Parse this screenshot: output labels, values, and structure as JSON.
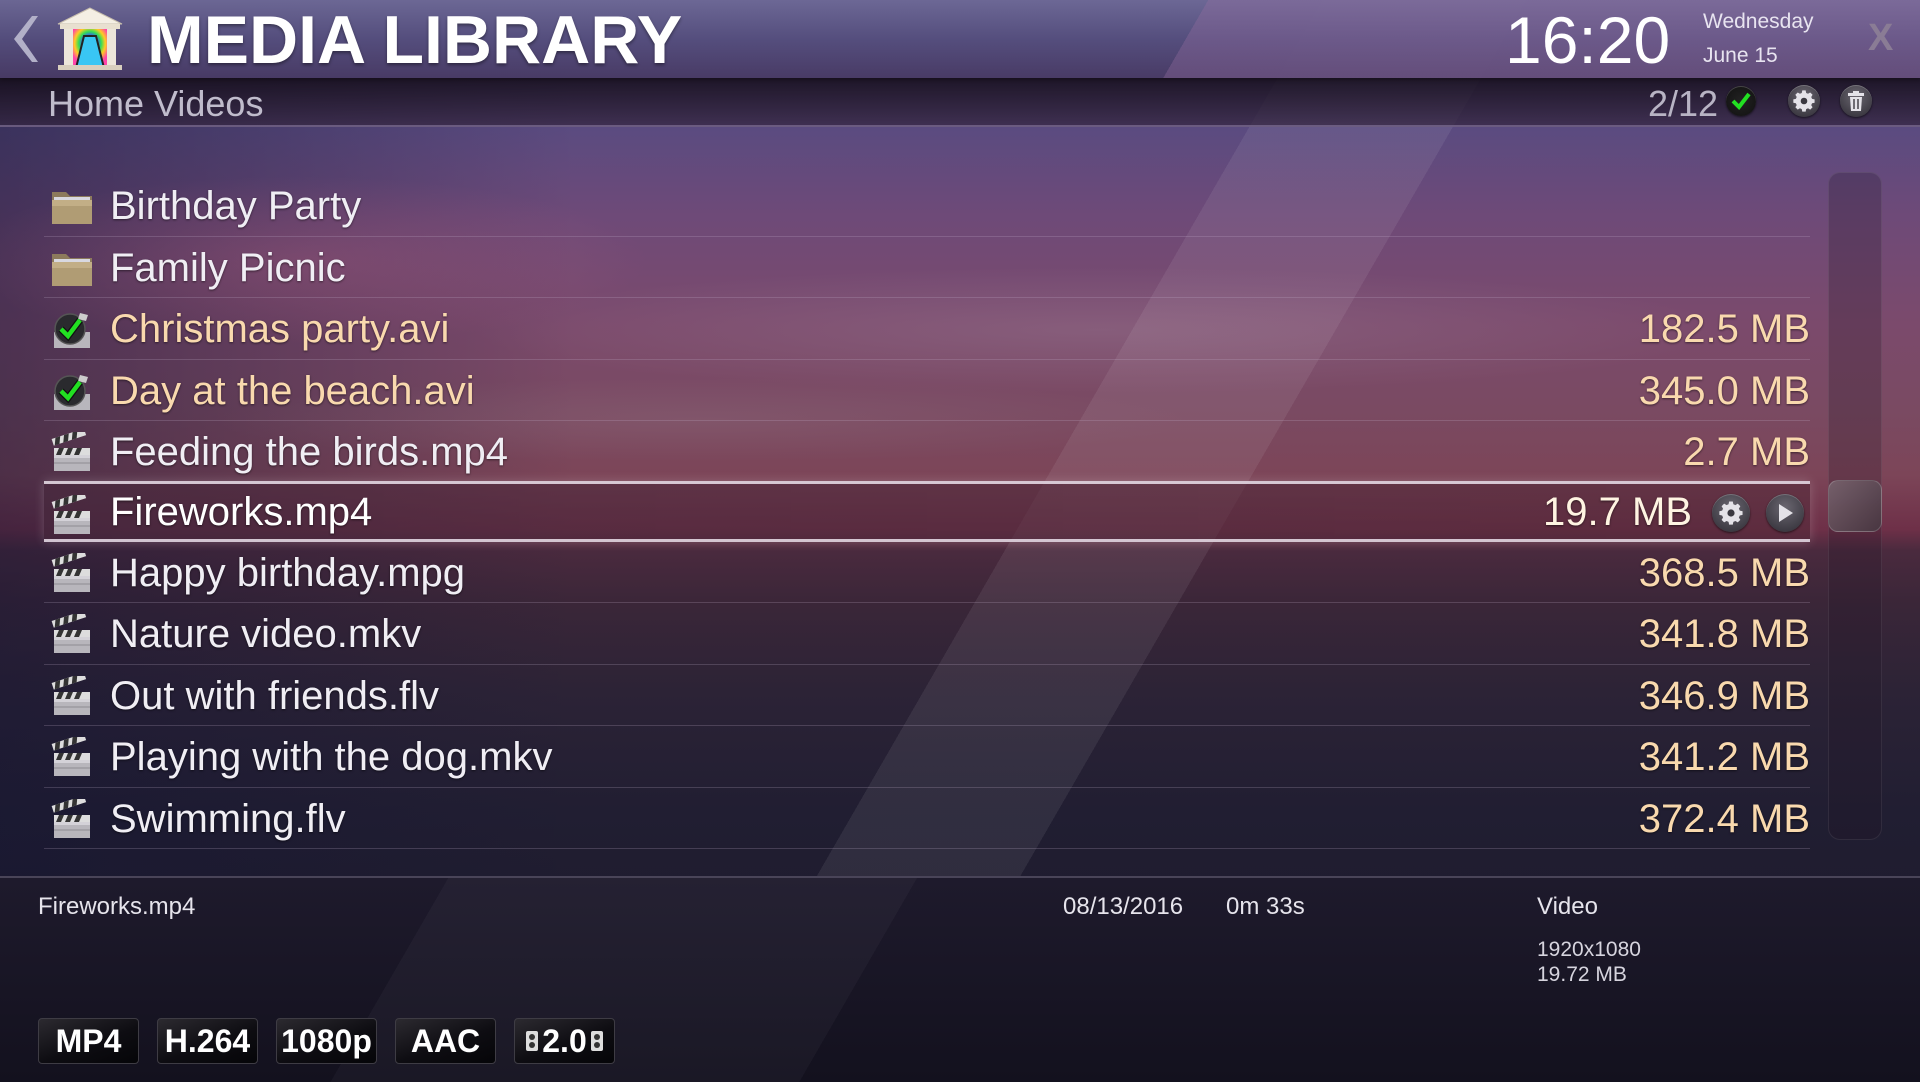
{
  "header": {
    "title": "MEDIA LIBRARY",
    "back_icon": "chevron-left-icon",
    "logo_icon": "media-library-logo-icon",
    "clock": "16:20",
    "day": "Wednesday",
    "date": "June 15",
    "close_label": "X"
  },
  "subheader": {
    "breadcrumb": "Home Videos",
    "counter": "2/12",
    "counter_icon": "checkmark-icon",
    "settings_icon": "gear-icon",
    "trash_icon": "trash-icon"
  },
  "colors": {
    "watched_text": "#f9d9ae",
    "normal_text": "#f0eef4",
    "check_green": "#22e022"
  },
  "files": [
    {
      "name": "Birthday Party",
      "type": "folder",
      "icon": "folder-icon",
      "size": "",
      "watched": false,
      "selected": false
    },
    {
      "name": "Family Picnic",
      "type": "folder",
      "icon": "folder-icon",
      "size": "",
      "watched": false,
      "selected": false
    },
    {
      "name": "Christmas party.avi",
      "type": "video",
      "icon": "watched-video-icon",
      "size": "182.5 MB",
      "watched": true,
      "selected": false
    },
    {
      "name": "Day at the beach.avi",
      "type": "video",
      "icon": "watched-video-icon",
      "size": "345.0 MB",
      "watched": true,
      "selected": false
    },
    {
      "name": "Feeding the birds.mp4",
      "type": "video",
      "icon": "clapperboard-icon",
      "size": "2.7 MB",
      "watched": false,
      "selected": false
    },
    {
      "name": "Fireworks.mp4",
      "type": "video",
      "icon": "clapperboard-icon",
      "size": "19.7 MB",
      "watched": false,
      "selected": true
    },
    {
      "name": "Happy birthday.mpg",
      "type": "video",
      "icon": "clapperboard-icon",
      "size": "368.5 MB",
      "watched": false,
      "selected": false
    },
    {
      "name": "Nature video.mkv",
      "type": "video",
      "icon": "clapperboard-icon",
      "size": "341.8 MB",
      "watched": false,
      "selected": false
    },
    {
      "name": "Out with friends.flv",
      "type": "video",
      "icon": "clapperboard-icon",
      "size": "346.9 MB",
      "watched": false,
      "selected": false
    },
    {
      "name": "Playing with the dog.mkv",
      "type": "video",
      "icon": "clapperboard-icon",
      "size": "341.2 MB",
      "watched": false,
      "selected": false
    },
    {
      "name": "Swimming.flv",
      "type": "video",
      "icon": "clapperboard-icon",
      "size": "372.4 MB",
      "watched": false,
      "selected": false
    }
  ],
  "selected_row_actions": {
    "settings_icon": "gear-icon",
    "play_icon": "play-icon"
  },
  "scrollbar": {
    "position_fraction": 0.5
  },
  "info": {
    "filename": "Fireworks.mp4",
    "date": "08/13/2016",
    "duration": "0m 33s",
    "kind": "Video",
    "resolution": "1920x1080",
    "size": "19.72 MB",
    "badges": [
      "MP4",
      "H.264",
      "1080p",
      "AAC",
      "2.0"
    ]
  }
}
